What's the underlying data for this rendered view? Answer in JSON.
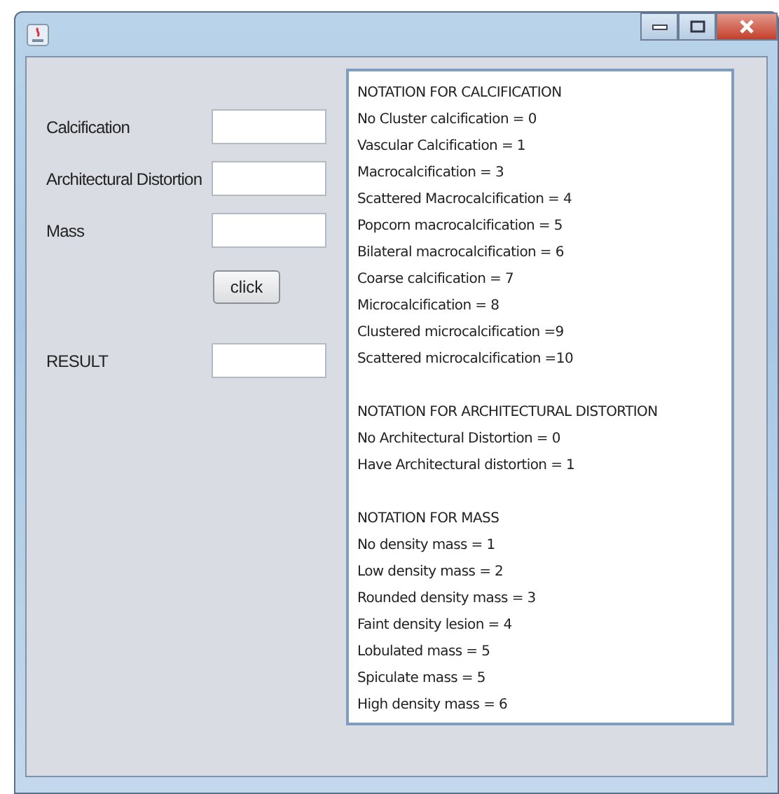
{
  "form": {
    "fields": [
      {
        "label": "Calcification"
      },
      {
        "label": "Architectural Distortion"
      },
      {
        "label": "Mass"
      }
    ],
    "button": "click",
    "result": {
      "label": "RESULT"
    }
  },
  "notations": [
    {
      "title": "NOTATION FOR CALCIFICATION",
      "lines": [
        "No Cluster calcification = 0",
        "Vascular Calcification = 1",
        "Macrocalcification = 3",
        "Scattered Macrocalcification = 4",
        "Popcorn macrocalcification = 5",
        "Bilateral macrocalcification = 6",
        "Coarse calcification = 7",
        "Microcalcification = 8",
        "Clustered microcalcification =9",
        "Scattered microcalcification =10"
      ]
    },
    {
      "title": "NOTATION FOR ARCHITECTURAL DISTORTION",
      "lines": [
        "No Architectural Distortion = 0",
        "Have Architectural distortion = 1"
      ]
    },
    {
      "title": "NOTATION FOR MASS",
      "lines": [
        "No density mass = 1",
        "Low density mass = 2",
        "Rounded density mass = 3",
        "Faint density lesion = 4",
        "Lobulated mass = 5",
        "Spiculate mass = 5",
        "High density mass = 6"
      ]
    }
  ]
}
